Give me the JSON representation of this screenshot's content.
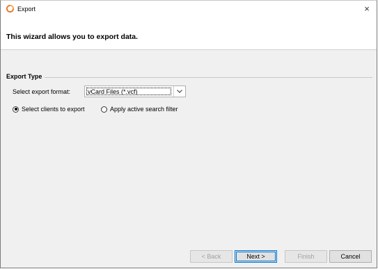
{
  "window": {
    "title": "Export",
    "close_glyph": "×"
  },
  "banner": {
    "text": "This wizard allows you to export data."
  },
  "export_type": {
    "group_label": "Export Type",
    "format_label": "Select export format:",
    "format_value": "vCard Files (*.vcf)",
    "radio_options": [
      {
        "label": "Select clients to export",
        "checked": true
      },
      {
        "label": "Apply active search filter",
        "checked": false
      }
    ]
  },
  "buttons": {
    "back": "< Back",
    "next": "Next >",
    "finish": "Finish",
    "cancel": "Cancel"
  },
  "icons": {
    "app": "app-logo-icon",
    "close": "close-icon",
    "dropdown": "chevron-down-icon",
    "radio": "radio-icon"
  },
  "colors": {
    "accent": "#0078d7",
    "logo_orange": "#e8731c"
  }
}
